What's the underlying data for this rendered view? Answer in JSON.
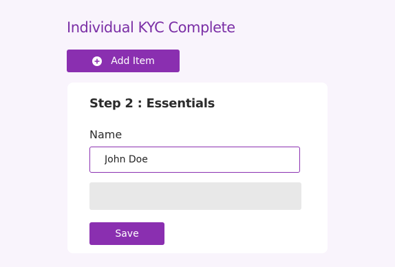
{
  "page": {
    "title": "Individual KYC Complete"
  },
  "toolbar": {
    "add_item_label": "Add Item",
    "add_icon": "plus-circle-icon"
  },
  "form": {
    "step_title": "Step 2 : Essentials",
    "name_label": "Name",
    "name_value": "John Doe",
    "save_label": "Save"
  },
  "colors": {
    "accent": "#8a2fb0",
    "title": "#7b2fa6",
    "background": "#f9f4fc"
  }
}
